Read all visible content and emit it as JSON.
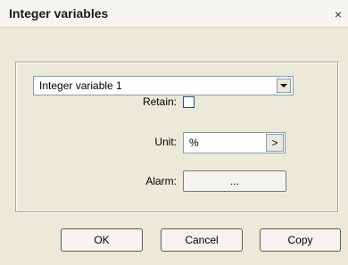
{
  "window": {
    "title": "Integer variables",
    "close_label": "×"
  },
  "variable_select": {
    "selected": "Integer variable 1"
  },
  "fields": {
    "retain_label": "Retain:",
    "retain_checked": false,
    "unit_label": "Unit:",
    "unit_value": "%",
    "unit_button_label": ">",
    "alarm_label": "Alarm:",
    "alarm_button_label": "..."
  },
  "buttons": {
    "ok": "OK",
    "cancel": "Cancel",
    "copy": "Copy"
  }
}
